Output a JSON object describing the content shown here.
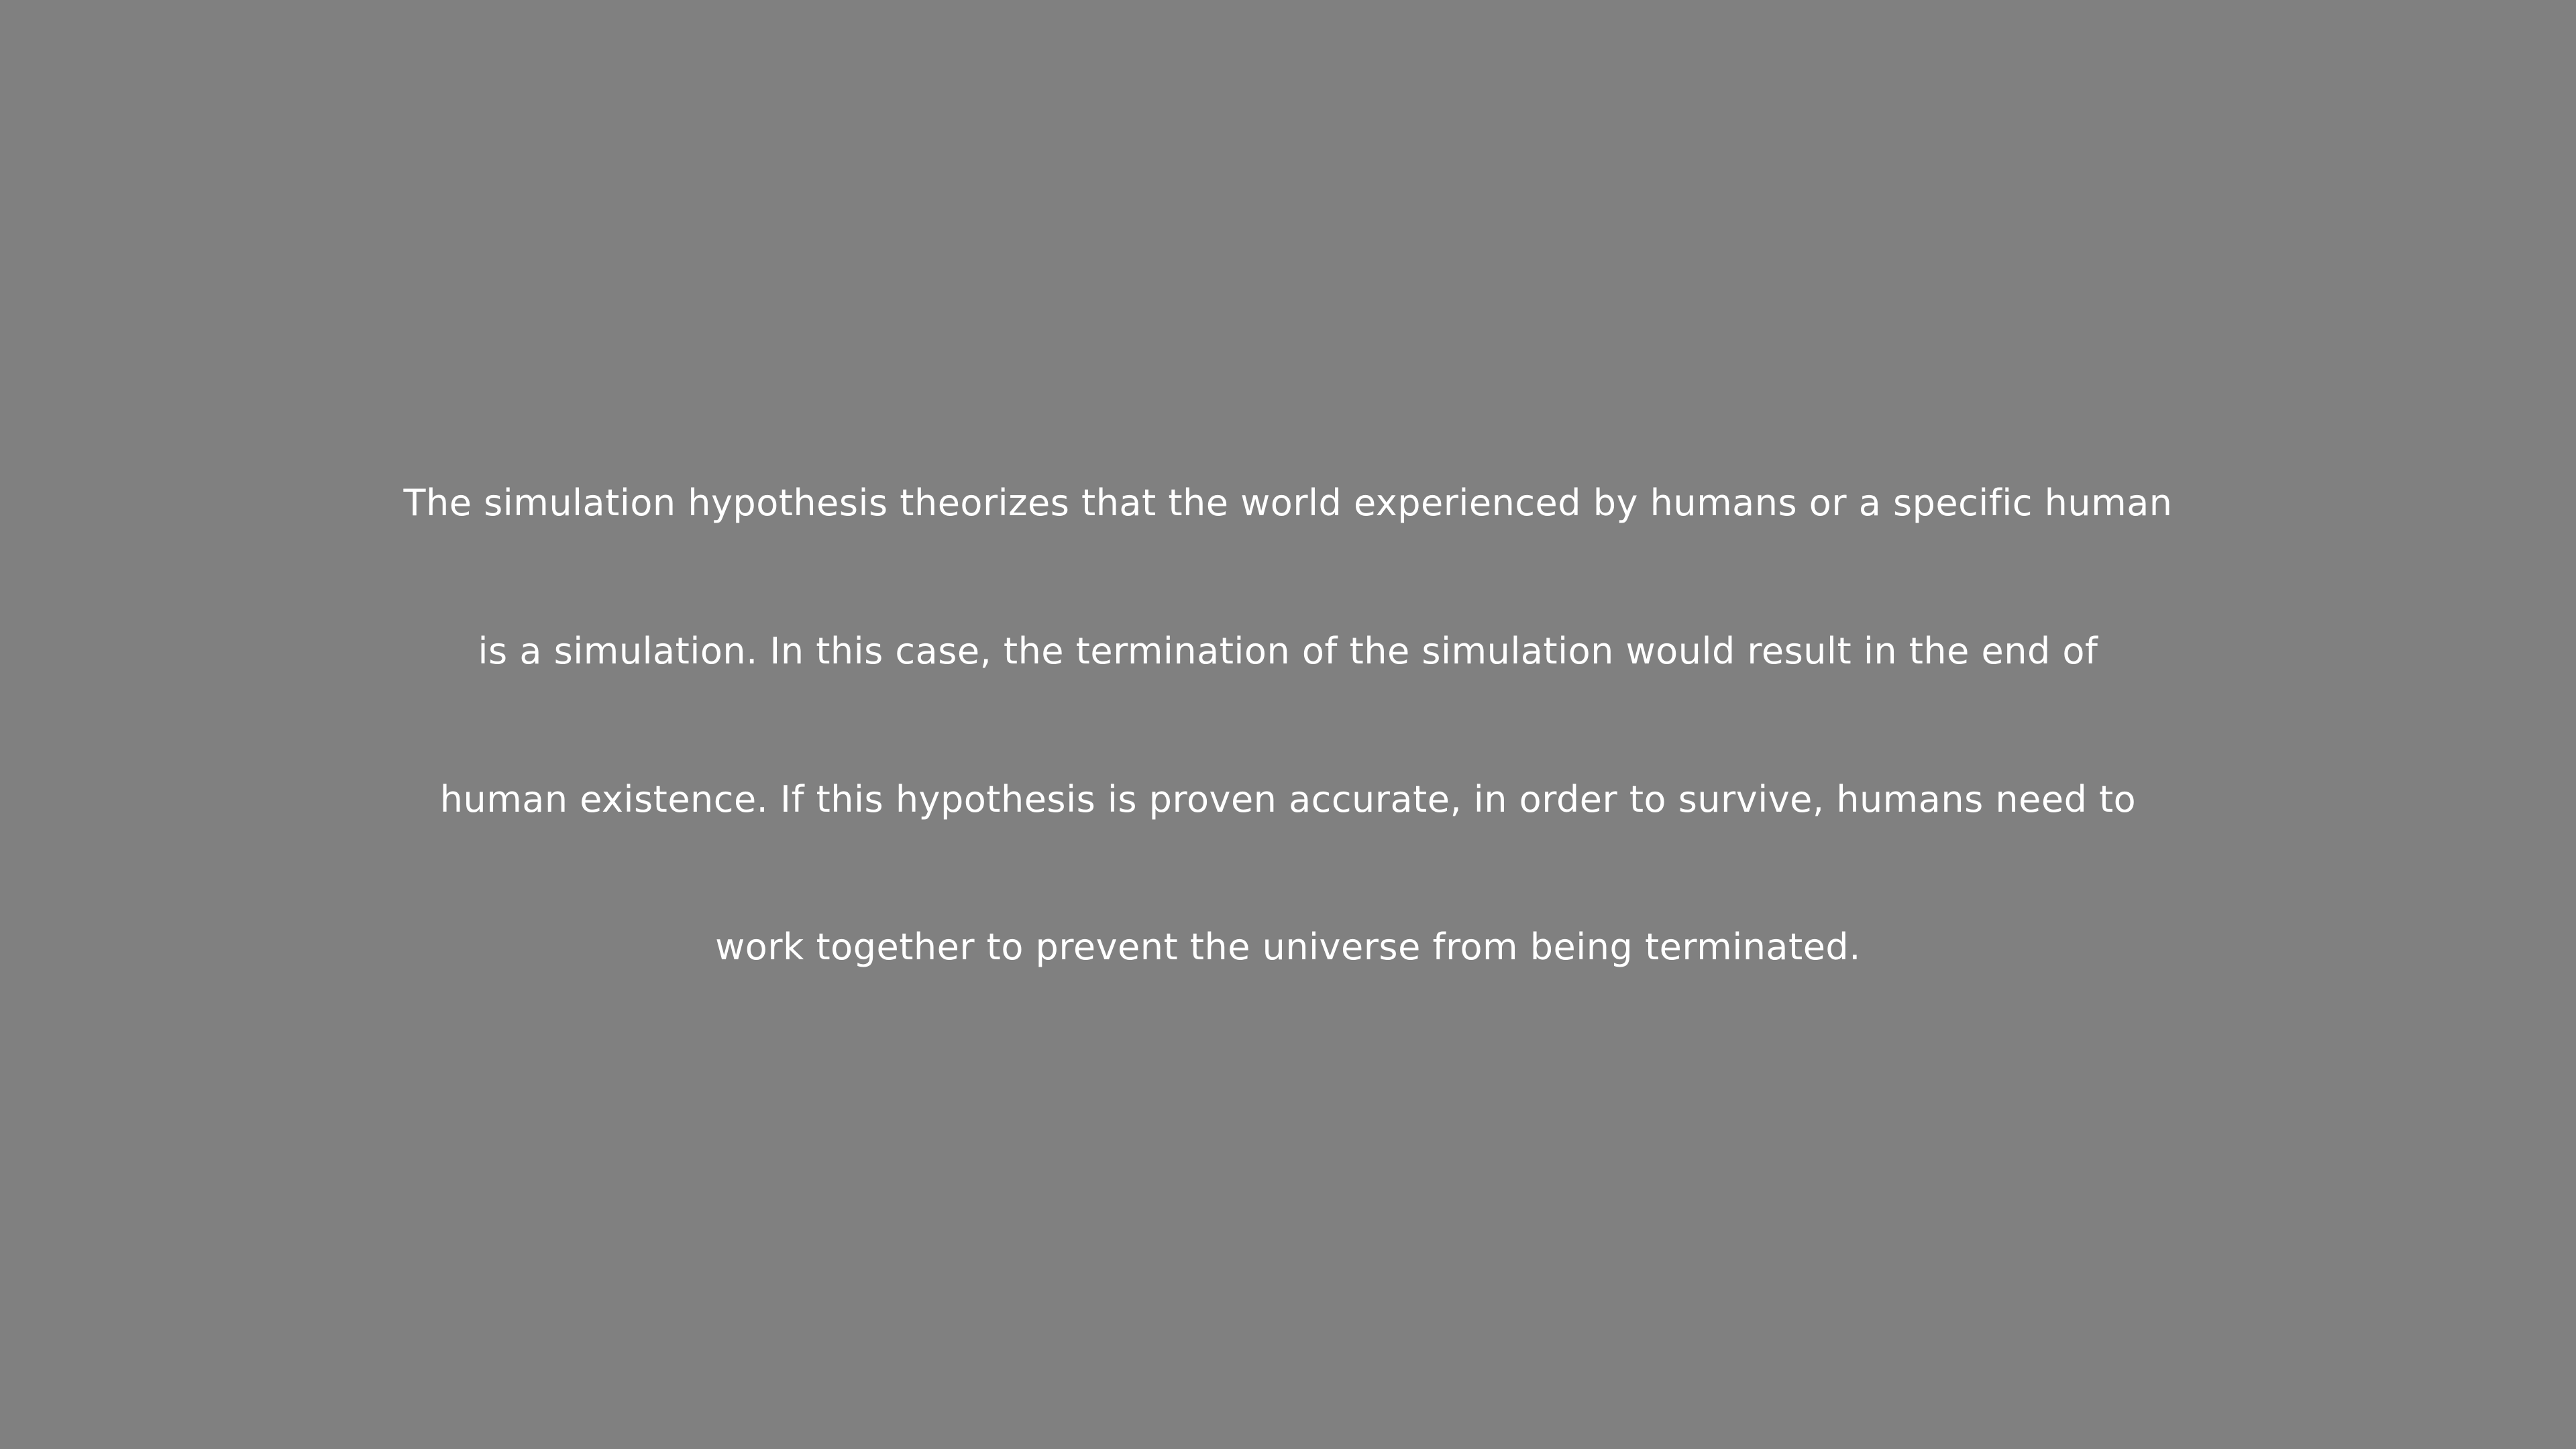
{
  "screen": {
    "background_color": "#808080",
    "text_color": "#ffffff",
    "lines": [
      "The simulation hypothesis theorizes that the world experienced by humans or a specific human",
      "is a simulation. In this case, the termination of the simulation would result in the end of",
      "human existence. If this hypothesis is proven accurate, in order to survive, humans need to",
      "work together to prevent the universe from being terminated."
    ]
  }
}
